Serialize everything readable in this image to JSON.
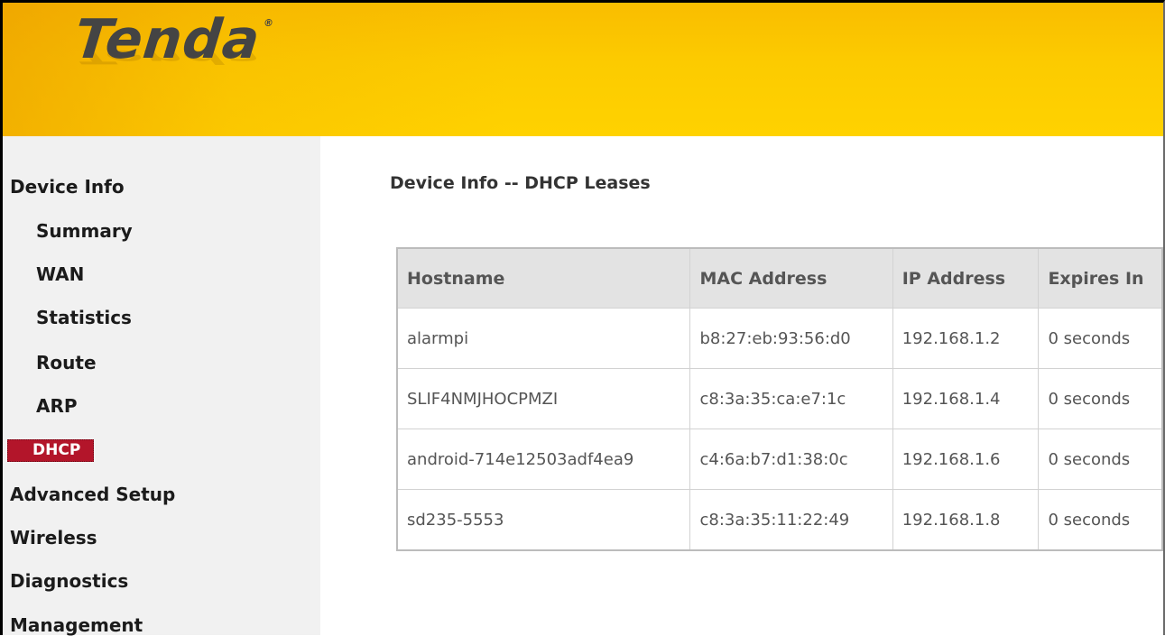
{
  "brand": {
    "logo_text": "Tenda",
    "registered_mark": "®"
  },
  "sidebar": {
    "items": [
      {
        "label": "Device Info",
        "level": "top"
      },
      {
        "label": "Summary",
        "level": "sub"
      },
      {
        "label": "WAN",
        "level": "sub"
      },
      {
        "label": "Statistics",
        "level": "sub"
      },
      {
        "label": "Route",
        "level": "sub"
      },
      {
        "label": "ARP",
        "level": "sub"
      },
      {
        "label": "DHCP",
        "level": "sub",
        "active": true
      },
      {
        "label": "Advanced Setup",
        "level": "top"
      },
      {
        "label": "Wireless",
        "level": "top"
      },
      {
        "label": "Diagnostics",
        "level": "top"
      },
      {
        "label": "Management",
        "level": "top"
      }
    ]
  },
  "main": {
    "title": "Device Info -- DHCP Leases",
    "table": {
      "columns": [
        "Hostname",
        "MAC Address",
        "IP Address",
        "Expires In"
      ],
      "rows": [
        [
          "alarmpi",
          "b8:27:eb:93:56:d0",
          "192.168.1.2",
          "0 seconds"
        ],
        [
          "SLIF4NMJHOCPMZI",
          "c8:3a:35:ca:e7:1c",
          "192.168.1.4",
          "0 seconds"
        ],
        [
          "android-714e12503adf4ea9",
          "c4:6a:b7:d1:38:0c",
          "192.168.1.6",
          "0 seconds"
        ],
        [
          "sd235-5553",
          "c8:3a:35:11:22:49",
          "192.168.1.8",
          "0 seconds"
        ]
      ]
    }
  },
  "colors": {
    "header_yellow": "#ffd200",
    "active_nav": "#b3152a",
    "sidebar_bg": "#f1f1f1",
    "table_header_bg": "#e3e3e3"
  }
}
